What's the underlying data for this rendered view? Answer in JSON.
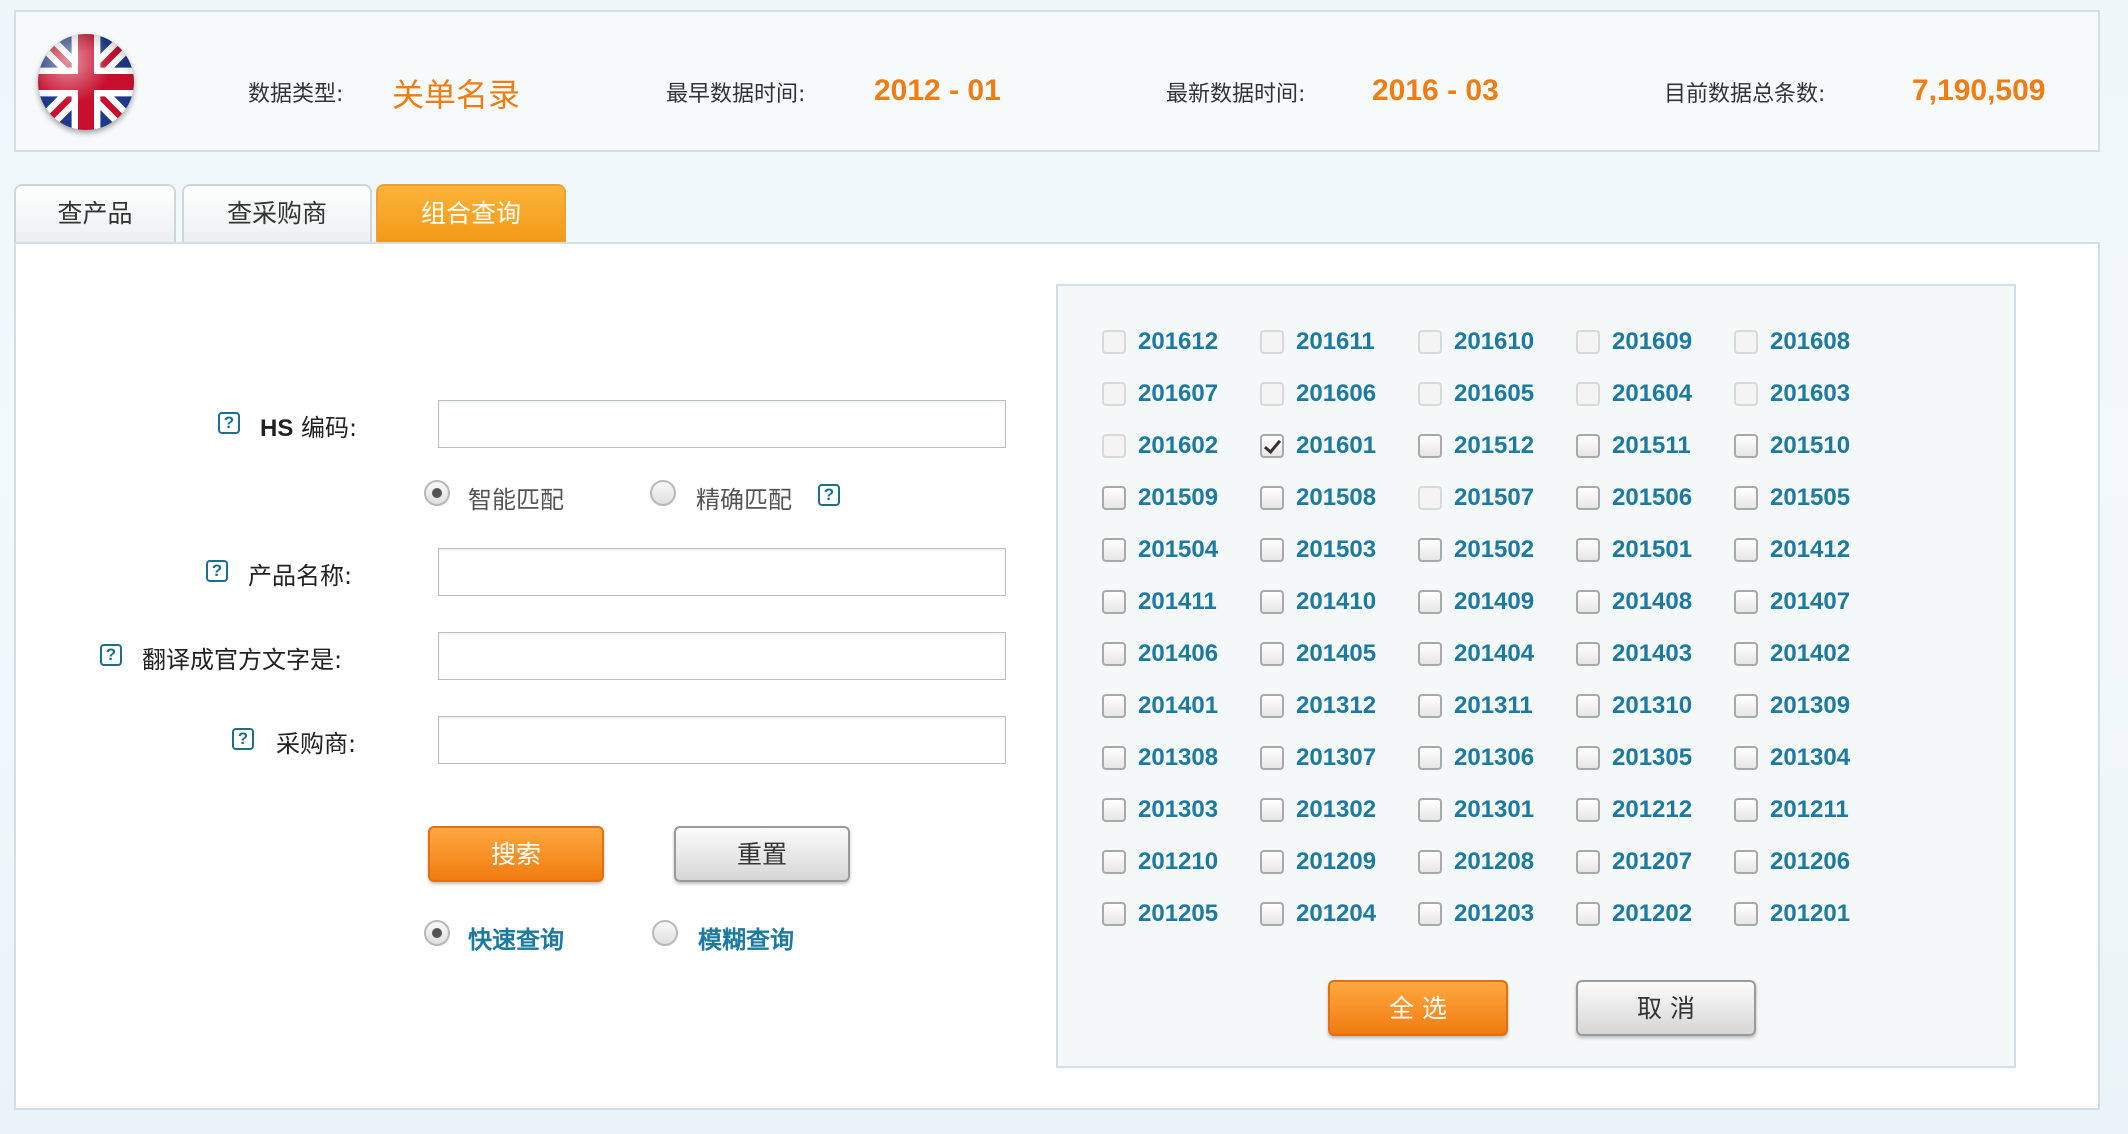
{
  "header": {
    "flag_icon": "uk-flag-globe-icon",
    "data_type_label": "数据类型:",
    "data_type_value": "关单名录",
    "earliest_label": "最早数据时间:",
    "earliest_value": "2012 - 01",
    "latest_label": "最新数据时间:",
    "latest_value": "2016 - 03",
    "total_label": "目前数据总条数:",
    "total_value": "7,190,509"
  },
  "tabs": [
    {
      "label": "查产品",
      "active": false
    },
    {
      "label": "查采购商",
      "active": false
    },
    {
      "label": "组合查询",
      "active": true
    }
  ],
  "form": {
    "hs_code_label_bold": "HS",
    "hs_code_label": " 编码:",
    "hs_code_value": "",
    "match_smart": "智能匹配",
    "match_exact": "精确匹配",
    "match_selected": "smart",
    "product_name_label": "产品名称:",
    "product_name_value": "",
    "translate_label": "翻译成官方文字是:",
    "translate_value": "",
    "buyer_label": "采购商:",
    "buyer_value": "",
    "search_button": "搜索",
    "reset_button": "重置",
    "quick_query": "快速查询",
    "fuzzy_query": "模糊查询",
    "query_selected": "quick",
    "help_icon": "question-mark-icon"
  },
  "dates": {
    "select_all_button": "全 选",
    "cancel_button": "取 消",
    "items": [
      {
        "label": "201612",
        "state": "disabled"
      },
      {
        "label": "201611",
        "state": "disabled"
      },
      {
        "label": "201610",
        "state": "disabled"
      },
      {
        "label": "201609",
        "state": "disabled"
      },
      {
        "label": "201608",
        "state": "disabled"
      },
      {
        "label": "201607",
        "state": "disabled"
      },
      {
        "label": "201606",
        "state": "disabled"
      },
      {
        "label": "201605",
        "state": "disabled"
      },
      {
        "label": "201604",
        "state": "disabled"
      },
      {
        "label": "201603",
        "state": "disabled"
      },
      {
        "label": "201602",
        "state": "disabled"
      },
      {
        "label": "201601",
        "state": "checked"
      },
      {
        "label": "201512",
        "state": "unchecked"
      },
      {
        "label": "201511",
        "state": "unchecked"
      },
      {
        "label": "201510",
        "state": "unchecked"
      },
      {
        "label": "201509",
        "state": "unchecked"
      },
      {
        "label": "201508",
        "state": "unchecked"
      },
      {
        "label": "201507",
        "state": "disabled"
      },
      {
        "label": "201506",
        "state": "unchecked"
      },
      {
        "label": "201505",
        "state": "unchecked"
      },
      {
        "label": "201504",
        "state": "unchecked"
      },
      {
        "label": "201503",
        "state": "unchecked"
      },
      {
        "label": "201502",
        "state": "unchecked"
      },
      {
        "label": "201501",
        "state": "unchecked"
      },
      {
        "label": "201412",
        "state": "unchecked"
      },
      {
        "label": "201411",
        "state": "unchecked"
      },
      {
        "label": "201410",
        "state": "unchecked"
      },
      {
        "label": "201409",
        "state": "unchecked"
      },
      {
        "label": "201408",
        "state": "unchecked"
      },
      {
        "label": "201407",
        "state": "unchecked"
      },
      {
        "label": "201406",
        "state": "unchecked"
      },
      {
        "label": "201405",
        "state": "unchecked"
      },
      {
        "label": "201404",
        "state": "unchecked"
      },
      {
        "label": "201403",
        "state": "unchecked"
      },
      {
        "label": "201402",
        "state": "unchecked"
      },
      {
        "label": "201401",
        "state": "unchecked"
      },
      {
        "label": "201312",
        "state": "unchecked"
      },
      {
        "label": "201311",
        "state": "unchecked"
      },
      {
        "label": "201310",
        "state": "unchecked"
      },
      {
        "label": "201309",
        "state": "unchecked"
      },
      {
        "label": "201308",
        "state": "unchecked"
      },
      {
        "label": "201307",
        "state": "unchecked"
      },
      {
        "label": "201306",
        "state": "unchecked"
      },
      {
        "label": "201305",
        "state": "unchecked"
      },
      {
        "label": "201304",
        "state": "unchecked"
      },
      {
        "label": "201303",
        "state": "unchecked"
      },
      {
        "label": "201302",
        "state": "unchecked"
      },
      {
        "label": "201301",
        "state": "unchecked"
      },
      {
        "label": "201212",
        "state": "unchecked"
      },
      {
        "label": "201211",
        "state": "unchecked"
      },
      {
        "label": "201210",
        "state": "unchecked"
      },
      {
        "label": "201209",
        "state": "unchecked"
      },
      {
        "label": "201208",
        "state": "unchecked"
      },
      {
        "label": "201207",
        "state": "unchecked"
      },
      {
        "label": "201206",
        "state": "unchecked"
      },
      {
        "label": "201205",
        "state": "unchecked"
      },
      {
        "label": "201204",
        "state": "unchecked"
      },
      {
        "label": "201203",
        "state": "unchecked"
      },
      {
        "label": "201202",
        "state": "unchecked"
      },
      {
        "label": "201201",
        "state": "unchecked"
      }
    ]
  },
  "colors": {
    "accent_orange": "#f07d12",
    "link_blue": "#1c7aa0"
  }
}
